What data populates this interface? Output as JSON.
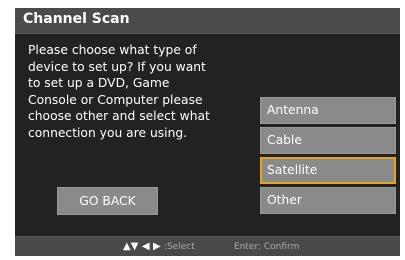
{
  "title": "Channel Scan",
  "prompt": "Please choose what type of\ndevice to set up? If you want\nto set up a DVD, Game\nConsole or Computer please\nchoose other and select what\nconnection you are using.",
  "options": [
    {
      "label": "Antenna",
      "selected": false
    },
    {
      "label": "Cable",
      "selected": false
    },
    {
      "label": "Satellite",
      "selected": true
    },
    {
      "label": "Other",
      "selected": false
    }
  ],
  "go_back_label": "GO BACK",
  "footer": {
    "nav_icons": "up-down-left-right-arrows-icon",
    "nav_glyphs": "▲▼ ◀ ▶",
    "nav_hint": ":Select",
    "confirm_hint": "Enter: Confirm"
  },
  "colors": {
    "background": "#222222",
    "title_bar": "#4b4b4b",
    "button": "#8a8a8a",
    "selected_border": "#e6a21c",
    "footer": "#494949"
  }
}
